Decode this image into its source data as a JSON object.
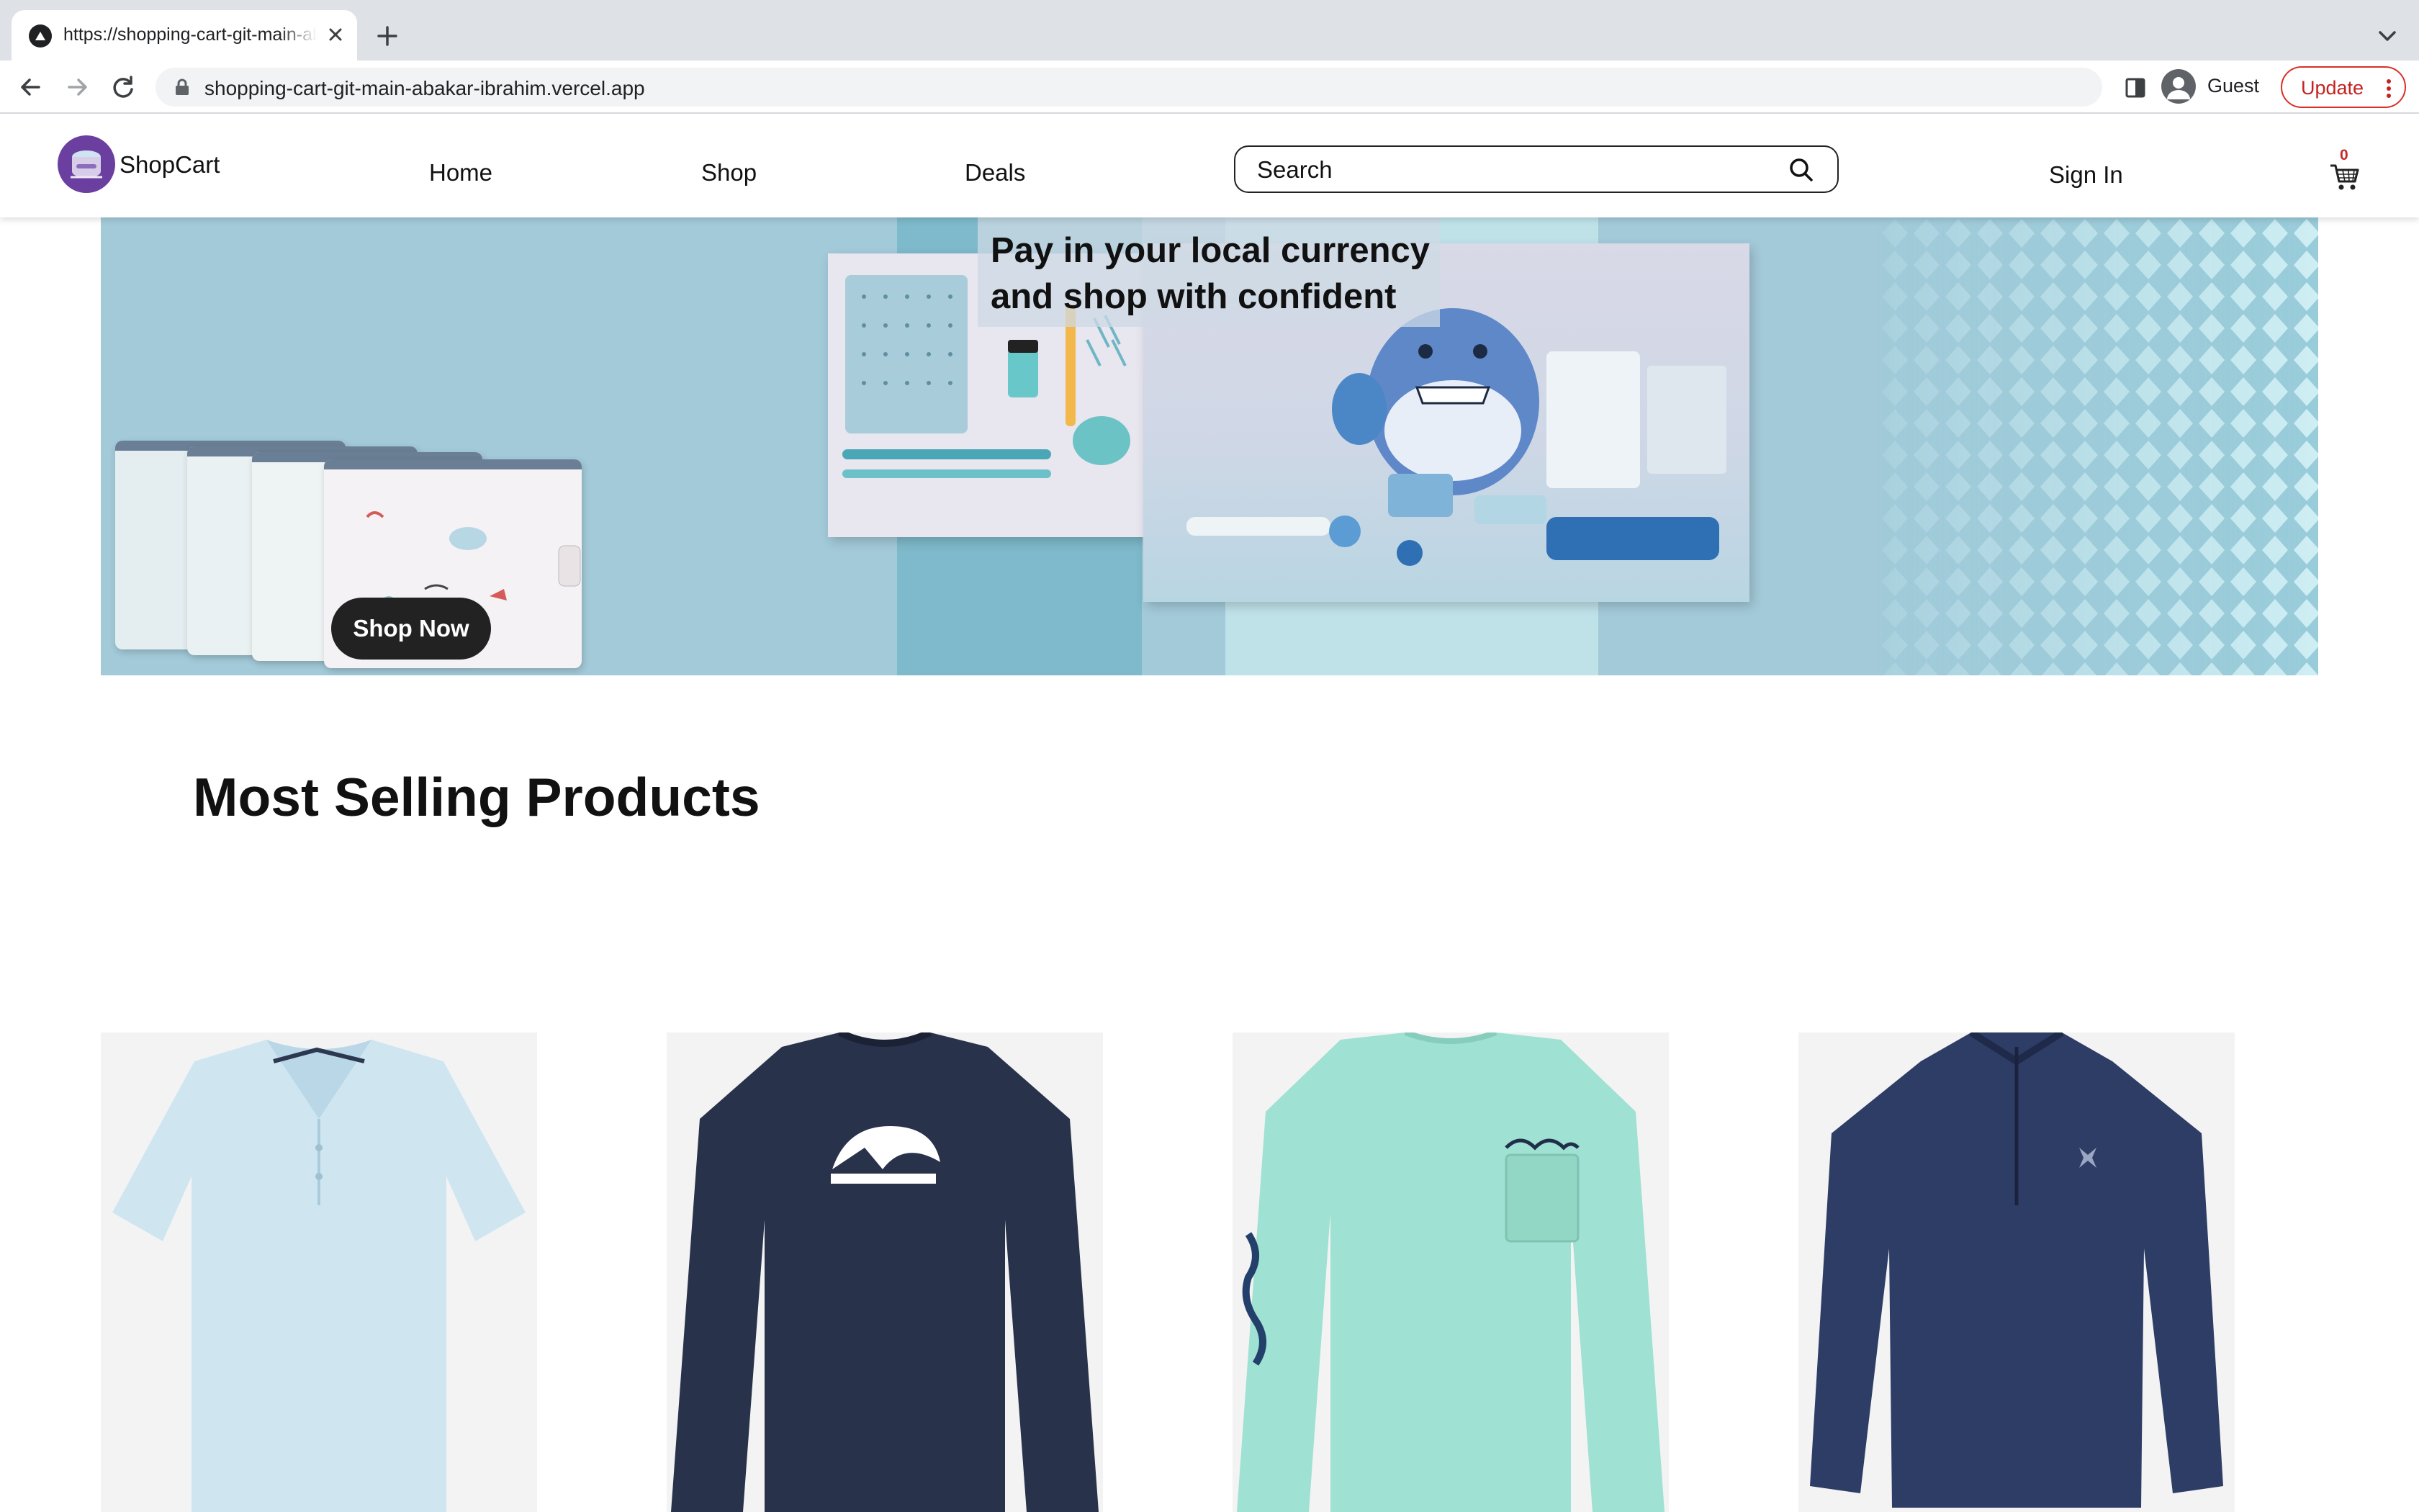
{
  "browser": {
    "tab_title": "https://shopping-cart-git-main-abakar-ibrahim.vercel.app",
    "url": "shopping-cart-git-main-abakar-ibrahim.vercel.app",
    "profile_label": "Guest",
    "update_label": "Update"
  },
  "site": {
    "brand": "ShopCart",
    "nav": [
      "Home",
      "Shop",
      "Deals"
    ],
    "search_placeholder": "Search",
    "sign_in": "Sign In",
    "cart_count": "0"
  },
  "hero": {
    "tagline": "Pay in your local currency and shop with confident",
    "button": "Shop Now"
  },
  "section": {
    "title": "Most Selling Products"
  },
  "products": [
    {
      "image": "light-blue-polo-shirt"
    },
    {
      "image": "navy-quiksilver-long-sleeve"
    },
    {
      "image": "mint-salt-life-long-sleeve"
    },
    {
      "image": "navy-quarter-zip-pullover"
    }
  ],
  "colors": {
    "brand_purple": "#6b3fa0",
    "hero_blue": "#a3cad9",
    "update_red": "#c5221f"
  }
}
